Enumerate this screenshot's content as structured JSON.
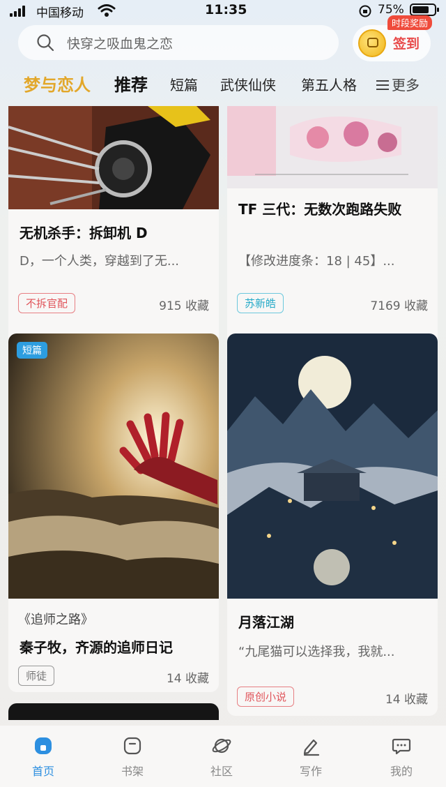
{
  "status_bar": {
    "carrier": "中国移动",
    "time": "11:35",
    "battery_percent": "75%",
    "battery_level": 0.75
  },
  "search": {
    "placeholder": "快穿之吸血鬼之恋"
  },
  "checkin": {
    "label": "签到",
    "badge": "时段奖励"
  },
  "tabs": {
    "brand": "梦与恋人",
    "items": [
      "推荐",
      "短篇",
      "武侠仙侠",
      "第五人格"
    ],
    "more": "更多",
    "active_index": 0
  },
  "feed": {
    "cards": [
      {
        "title": "无机杀手：拆卸机 D",
        "description": "D，一个人类，穿越到了无...",
        "tag": "不拆官配",
        "favorites": "915 收藏"
      },
      {
        "title": "TF 三代：无数次跑路失败",
        "description": "【修改进度条：18 | 45】...",
        "tag": "苏新皓",
        "favorites": "7169 收藏"
      },
      {
        "badge": "短篇",
        "series": "《追师之路》",
        "title": "秦子牧，齐源的追师日记",
        "tag": "师徒",
        "favorites": "14 收藏"
      },
      {
        "title": "月落江湖",
        "description": "“九尾猫可以选择我，我就...",
        "tag": "原创小说",
        "favorites": "14 收藏"
      }
    ]
  },
  "bottom_nav": {
    "items": [
      {
        "label": "首页",
        "icon": "home-icon"
      },
      {
        "label": "书架",
        "icon": "bookshelf-icon"
      },
      {
        "label": "社区",
        "icon": "planet-icon"
      },
      {
        "label": "写作",
        "icon": "pen-icon"
      },
      {
        "label": "我的",
        "icon": "chat-bubble-icon"
      }
    ],
    "active_index": 0
  },
  "colors": {
    "brand": "#e2a72a",
    "accent": "#2d8fe0",
    "checkin": "#e84a4a"
  }
}
